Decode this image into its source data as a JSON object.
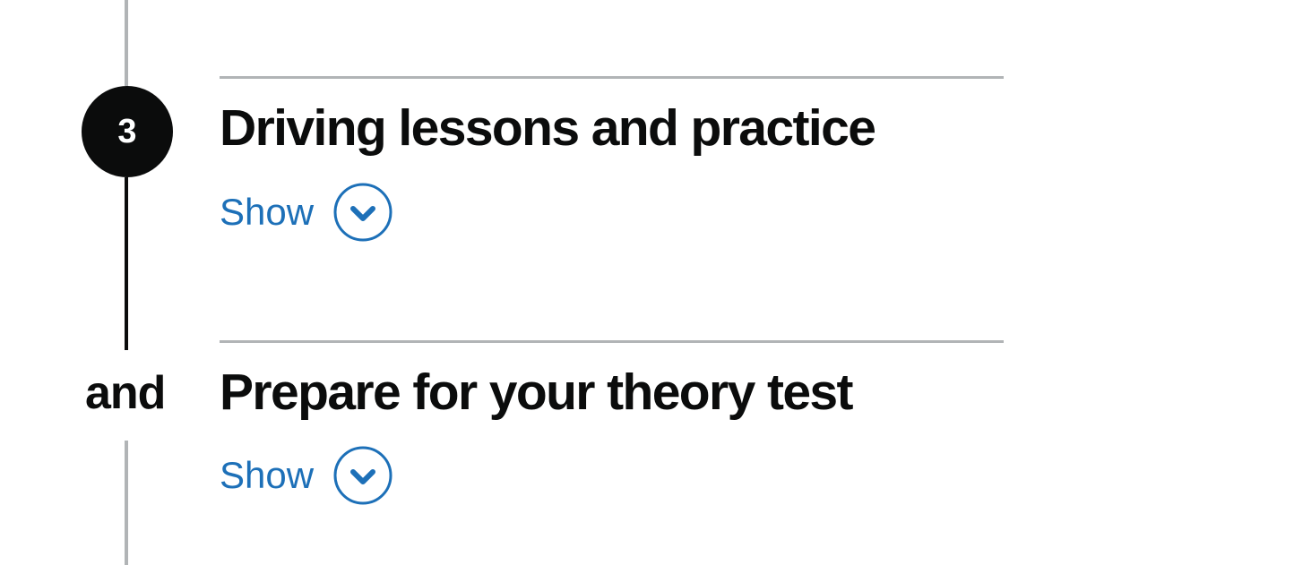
{
  "steps": [
    {
      "marker": "3",
      "title": "Driving lessons and practice",
      "toggle_label": "Show",
      "toggle_icon": "chevron-down-icon"
    },
    {
      "marker": "and",
      "title": "Prepare for your theory test",
      "toggle_label": "Show",
      "toggle_icon": "chevron-down-icon"
    }
  ],
  "colors": {
    "text": "#0b0c0c",
    "link": "#1d70b8",
    "line_grey": "#b1b4b6",
    "line_active": "#0b0c0c"
  }
}
